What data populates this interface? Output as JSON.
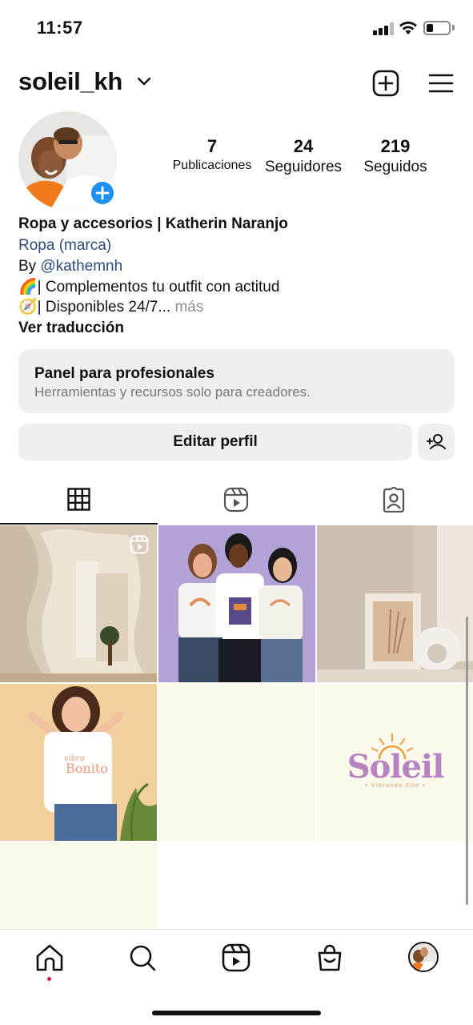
{
  "status_bar": {
    "time": "11:57"
  },
  "header": {
    "username": "soleil_kh"
  },
  "stats": [
    {
      "value": "7",
      "label": "Publicaciones"
    },
    {
      "value": "24",
      "label": "Seguidores"
    },
    {
      "value": "219",
      "label": "Seguidos"
    }
  ],
  "bio": {
    "name": "Ropa y accesorios | Katherin Naranjo",
    "category": "Ropa (marca)",
    "by_prefix": "By ",
    "mention": "@kathemnh",
    "line1_emoji": "🌈",
    "line1": "| Complementos tu outfit con actitud",
    "line2_emoji": "🧭",
    "line2": "| Disponibles 24/7...",
    "more": " más",
    "translate": "Ver traducción"
  },
  "pro_panel": {
    "title": "Panel para profesionales",
    "subtitle": "Herramientas y recursos solo para creadores."
  },
  "buttons": {
    "edit_profile": "Editar perfil"
  },
  "tabs": [
    {
      "icon": "grid-icon",
      "active": true
    },
    {
      "icon": "reels-icon",
      "active": false
    },
    {
      "icon": "tagged-icon",
      "active": false
    }
  ],
  "grid_posts": {
    "post5_brand": "Soleil",
    "post5_tagline": "• Vibrando Alto •",
    "post4_shirt_text": "Bonito",
    "post4_shirt_small": "vibra"
  },
  "bottom_nav": [
    "home-icon",
    "search-icon",
    "reels-icon",
    "shop-icon",
    "profile-avatar"
  ],
  "colors": {
    "accent_blue": "#1e90f0",
    "link": "#2c4a7a",
    "notification_dot": "#e0174a"
  }
}
